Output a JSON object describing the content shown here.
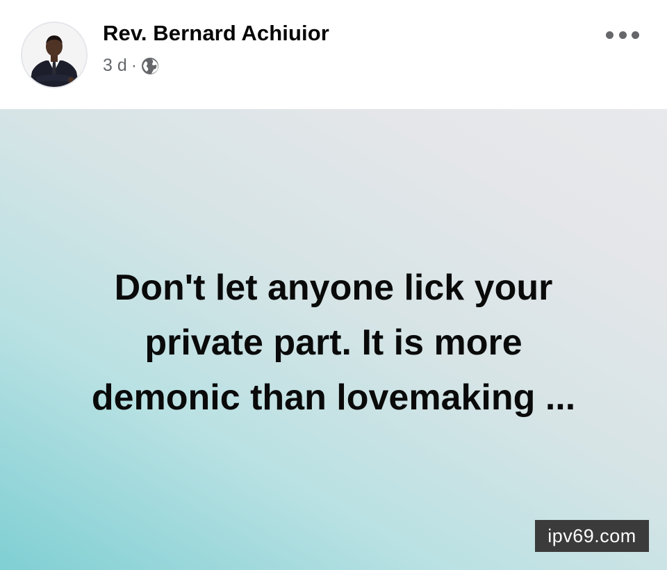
{
  "post": {
    "author": {
      "name": "Rev. Bernard Achiuior"
    },
    "meta": {
      "time": "3 d",
      "separator": "·",
      "audience_icon": "globe-icon"
    },
    "more_icon": "more-options-icon",
    "text": "Don't let anyone lick your\nprivate part. It is more\ndemonic than lovemaking ...",
    "background_colors": [
      "#7fcfd3",
      "#e8e9ec"
    ]
  },
  "watermark": {
    "text": "ipv69.com"
  }
}
